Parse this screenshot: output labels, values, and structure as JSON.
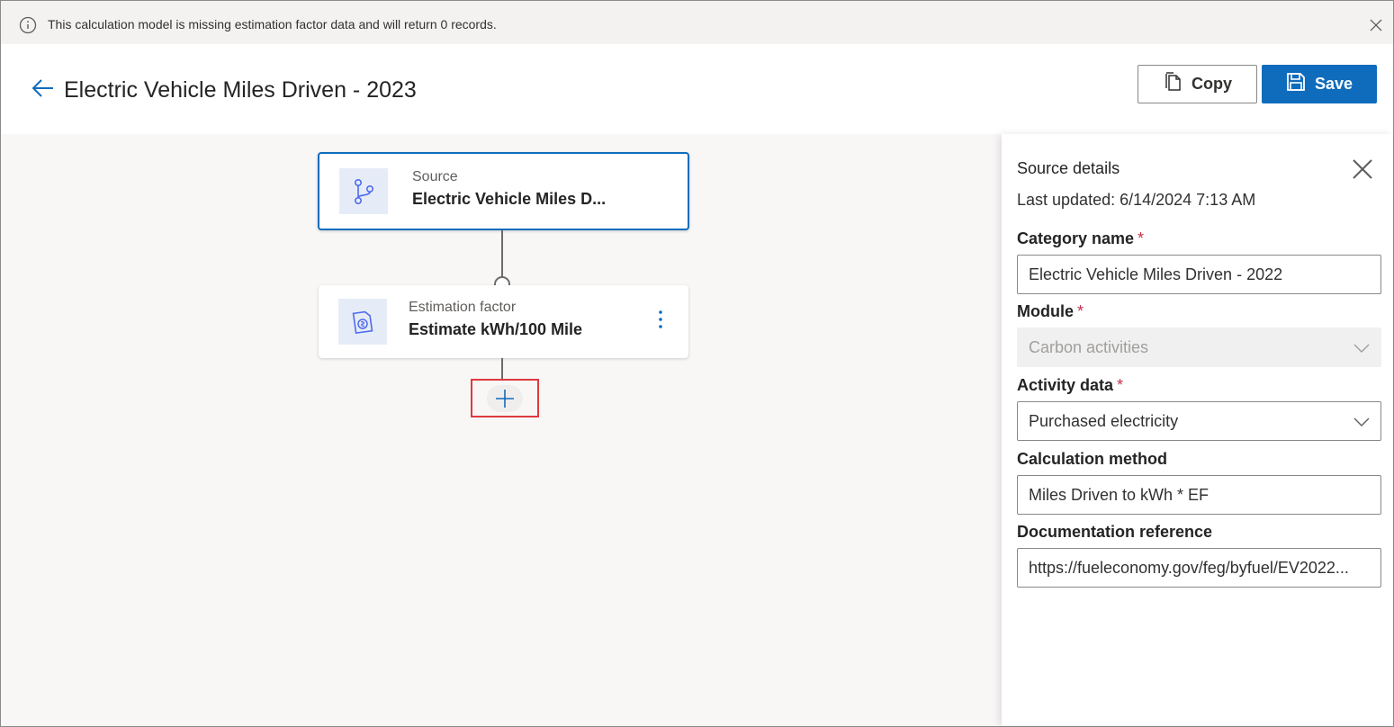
{
  "banner": {
    "message": "This calculation model is missing estimation factor data and will return 0 records.",
    "icon": "info-icon",
    "dismiss_icon": "close-icon"
  },
  "header": {
    "title": "Electric Vehicle Miles Driven - 2023",
    "copy_label": "Copy",
    "save_label": "Save",
    "accent_color": "#0f6cbd"
  },
  "canvas": {
    "nodes": [
      {
        "kind": "Source",
        "name": "Electric Vehicle Miles D...",
        "icon": "branch-icon",
        "selected": true
      },
      {
        "kind": "Estimation factor",
        "name": "Estimate kWh/100 Mile",
        "icon": "estimation-factor-icon",
        "selected": false
      }
    ],
    "add_step_icon": "plus-icon"
  },
  "panel": {
    "title": "Source details",
    "last_updated": "Last updated: 6/14/2024 7:13 AM",
    "fields": {
      "category_name": {
        "label": "Category name",
        "required": "*",
        "value": "Electric Vehicle Miles Driven - 2022"
      },
      "module": {
        "label": "Module",
        "required": "*",
        "value": "Carbon activities",
        "disabled": true
      },
      "activity_data": {
        "label": "Activity data",
        "required": "*",
        "value": "Purchased electricity"
      },
      "calculation_method": {
        "label": "Calculation method",
        "value": "Miles Driven to kWh * EF"
      },
      "documentation_reference": {
        "label": "Documentation reference",
        "value": "https://fueleconomy.gov/feg/byfuel/EV2022..."
      }
    }
  }
}
